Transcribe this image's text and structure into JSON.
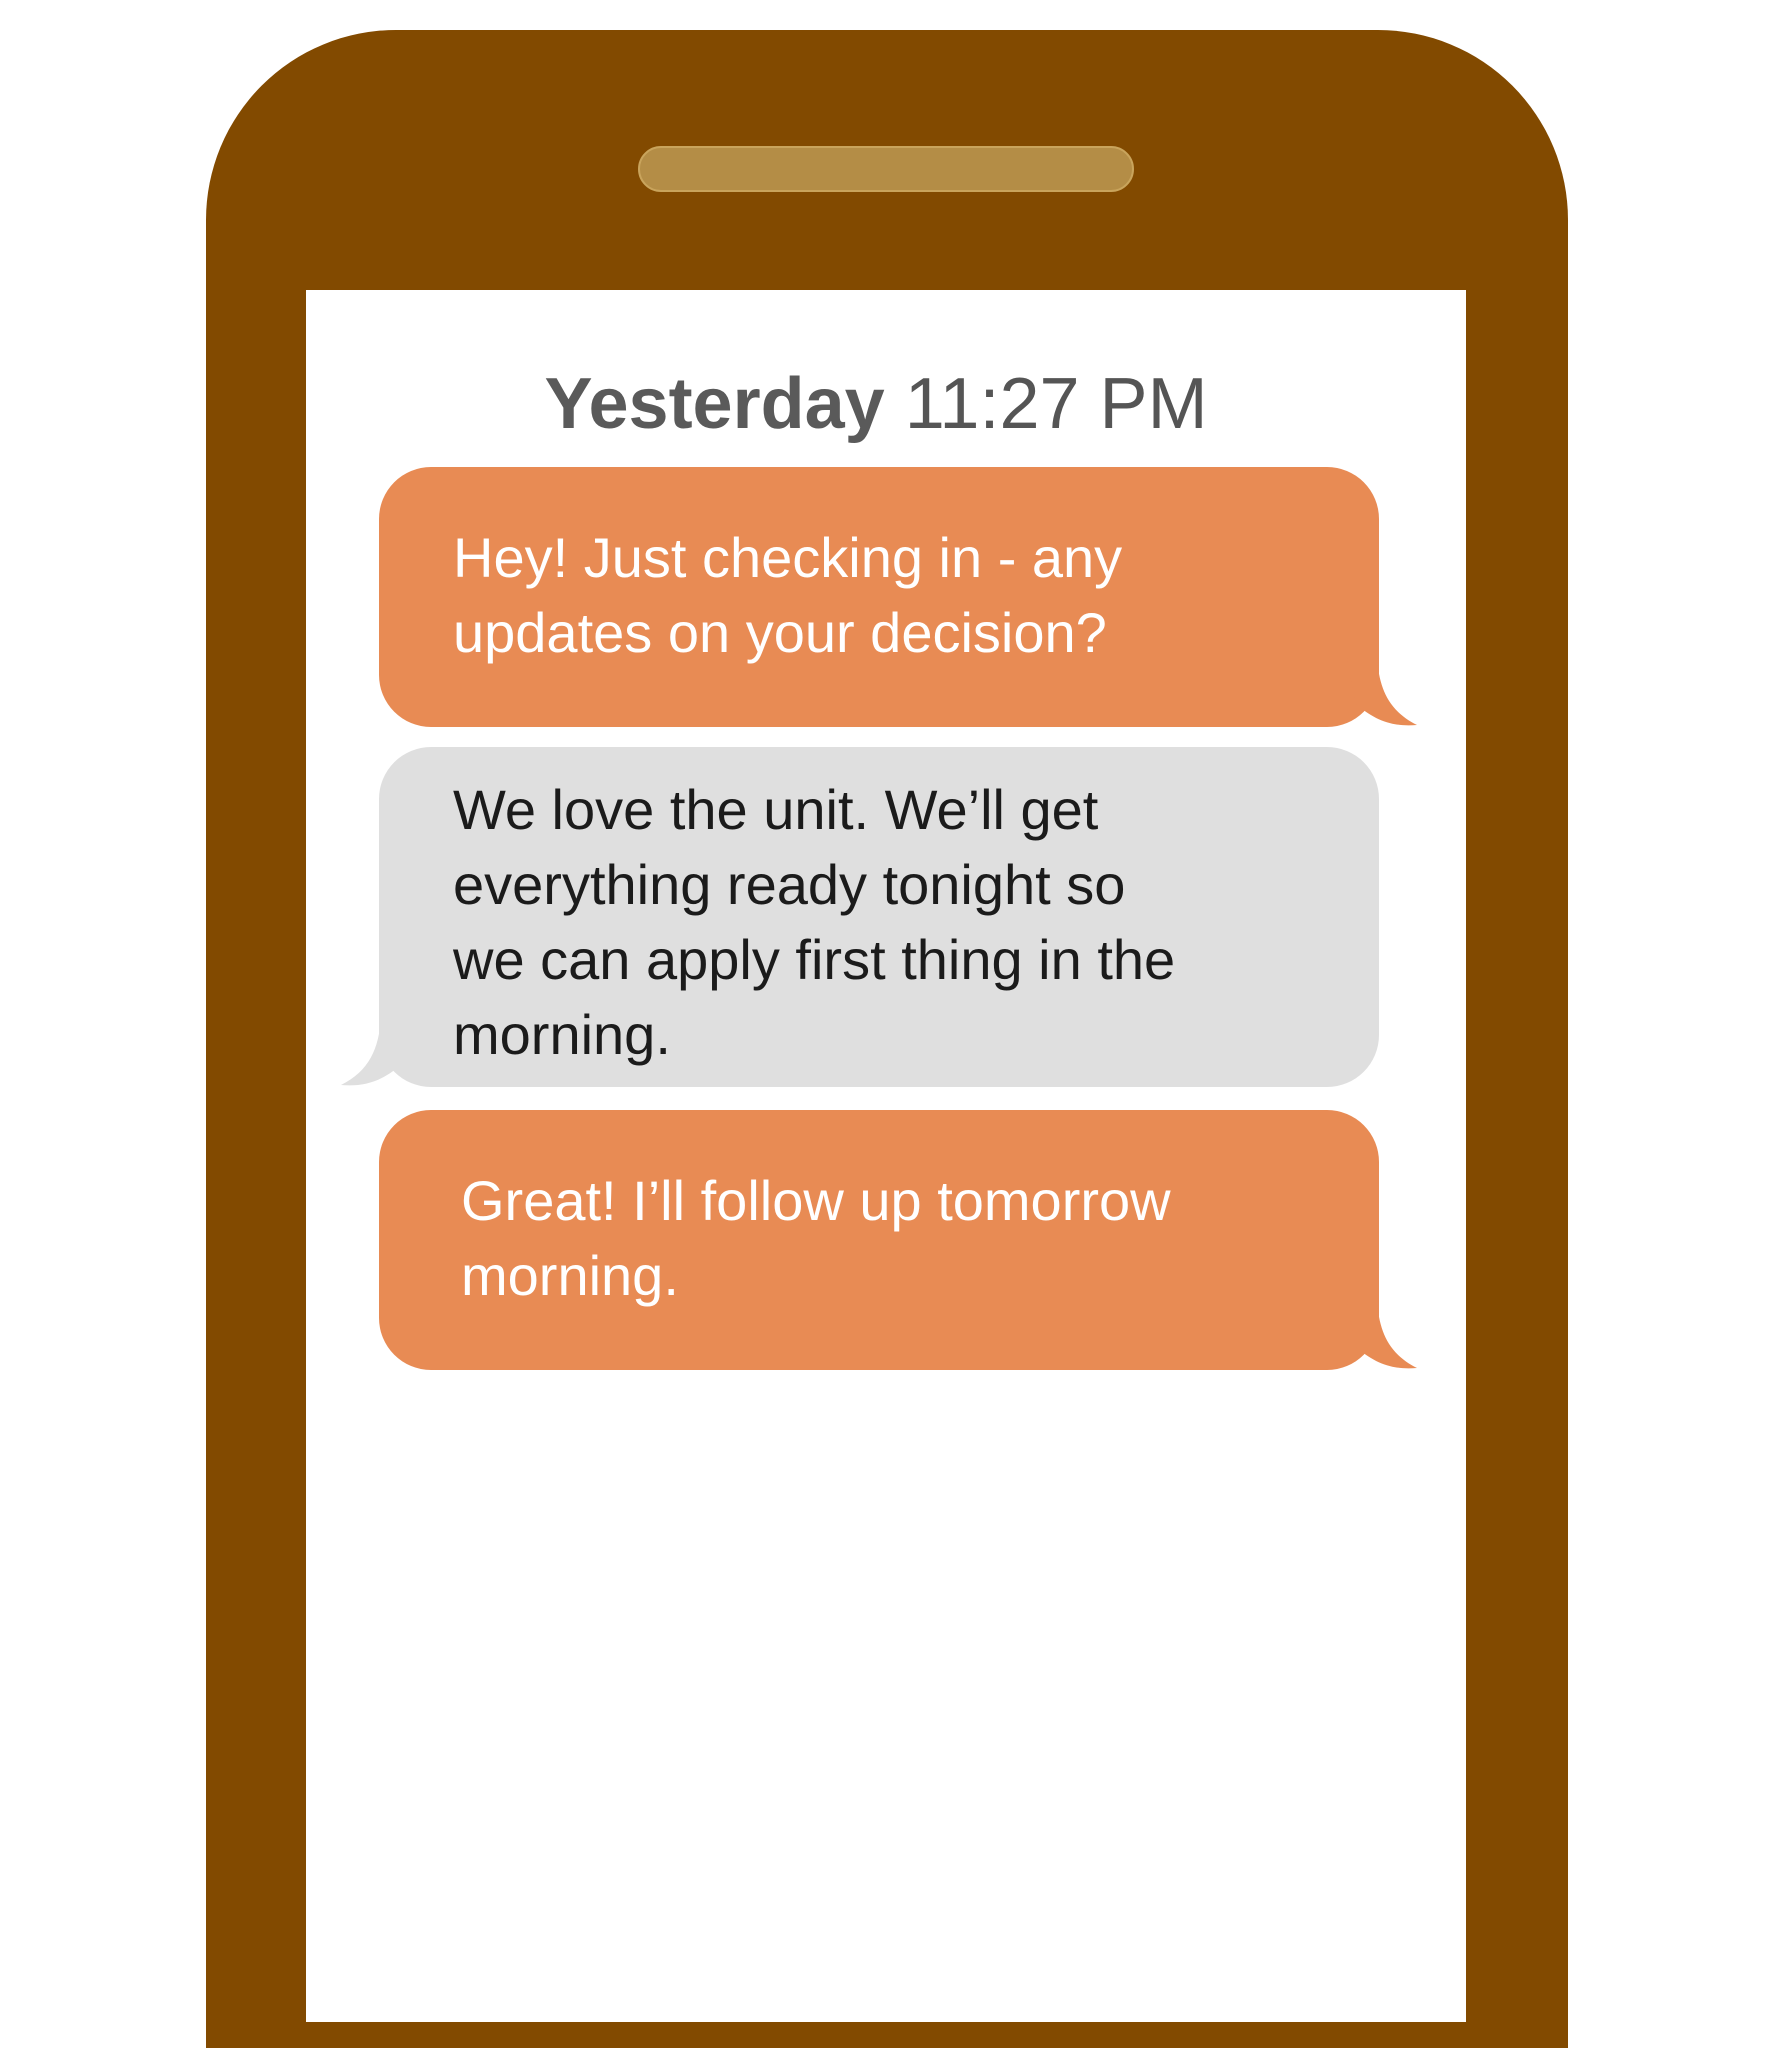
{
  "conversation": {
    "timestamp_day": "Yesterday",
    "timestamp_time": "11:27 PM",
    "messages": [
      {
        "direction": "sent",
        "lines": [
          "Hey! Just checking in - any",
          "updates on your decision?"
        ]
      },
      {
        "direction": "received",
        "lines": [
          "We love the unit. We’ll get",
          "everything ready tonight so",
          "we can apply first thing in the",
          "morning."
        ]
      },
      {
        "direction": "sent",
        "lines": [
          "Great! I’ll follow up tomorrow",
          "morning."
        ]
      }
    ]
  },
  "colors": {
    "phone_body": "#824a00",
    "speaker": "#b48d46",
    "sent_bubble": "#e88b54",
    "received_bubble": "#dfdfdf"
  }
}
